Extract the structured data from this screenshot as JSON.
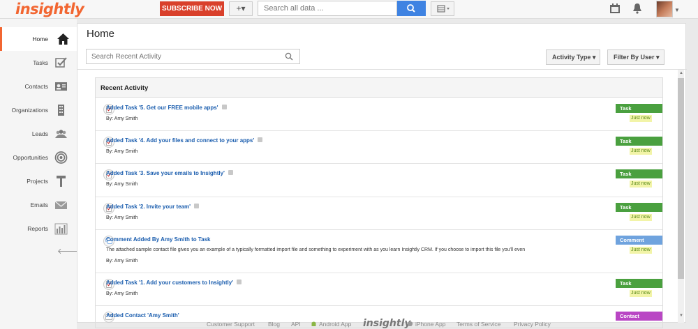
{
  "app": {
    "logo": "insightly",
    "subscribe_label": "SUBSCRIBE NOW",
    "add_label": "+▾",
    "search_placeholder": "Search all data ...",
    "accent_color": "#f26631"
  },
  "sidebar": {
    "items": [
      {
        "label": "Home",
        "icon": "home-icon",
        "active": true
      },
      {
        "label": "Tasks",
        "icon": "tasks-icon"
      },
      {
        "label": "Contacts",
        "icon": "contacts-icon"
      },
      {
        "label": "Organizations",
        "icon": "organizations-icon"
      },
      {
        "label": "Leads",
        "icon": "leads-icon"
      },
      {
        "label": "Opportunities",
        "icon": "opportunities-icon"
      },
      {
        "label": "Projects",
        "icon": "projects-icon"
      },
      {
        "label": "Emails",
        "icon": "emails-icon"
      },
      {
        "label": "Reports",
        "icon": "reports-icon"
      }
    ],
    "collapse": "🡐"
  },
  "main": {
    "title": "Home",
    "search_placeholder": "Search Recent Activity",
    "activity_type_label": "Activity Type ▾",
    "filter_user_label": "Filter By User ▾",
    "recent_activity_title": "Recent Activity",
    "items": [
      {
        "title": "Added Task '5. Get our FREE mobile apps'",
        "by": "By: Amy Smith",
        "badge": "Task",
        "badge_type": "task",
        "time": "Just now"
      },
      {
        "title": "Added Task '4. Add your files and connect to your apps'",
        "by": "By: Amy Smith",
        "badge": "Task",
        "badge_type": "task",
        "time": "Just now"
      },
      {
        "title": "Added Task '3. Save your emails to Insightly'",
        "by": "By: Amy Smith",
        "badge": "Task",
        "badge_type": "task",
        "time": "Just now"
      },
      {
        "title": "Added Task '2. Invite your team'",
        "by": "By: Amy Smith",
        "badge": "Task",
        "badge_type": "task",
        "time": "Just now"
      },
      {
        "title": "Comment Added By Amy Smith to Task",
        "desc": "The attached sample contact file gives you an example of a typically formatted import file and something to experiment with as you learn Insightly CRM. If you choose to import this file you'll even",
        "by": "By: Amy Smith",
        "badge": "Comment",
        "badge_type": "comment",
        "time": "Just now"
      },
      {
        "title": "Added Task '1. Add your customers to Insightly'",
        "by": "By: Amy Smith",
        "badge": "Task",
        "badge_type": "task",
        "time": "Just now"
      },
      {
        "title": "Added Contact 'Amy Smith'",
        "by": "",
        "badge": "Contact",
        "badge_type": "contact",
        "time": ""
      }
    ]
  },
  "footer": {
    "links": [
      "Customer Support",
      "Blog",
      "API",
      "Android App",
      "iPhone App",
      "Terms of Service",
      "Privacy Policy"
    ],
    "logo": "insightly"
  }
}
